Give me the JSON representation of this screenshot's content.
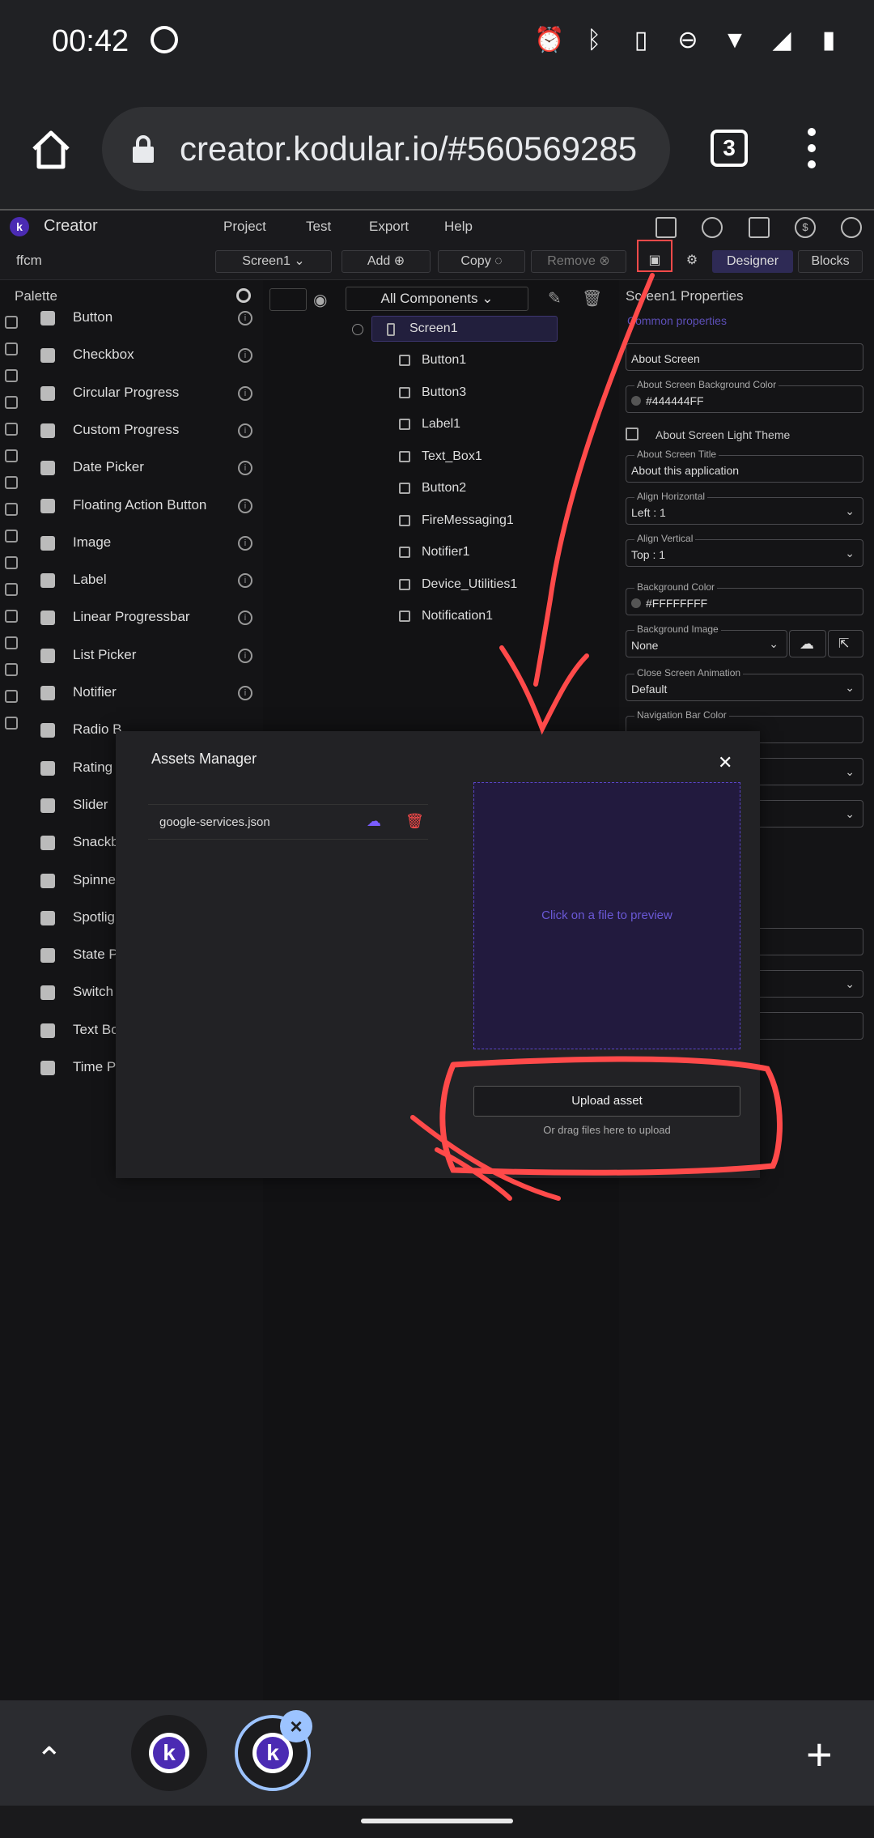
{
  "status": {
    "time": "00:42"
  },
  "browser": {
    "url": "creator.kodular.io/#560569285",
    "tab_count": "3"
  },
  "app": {
    "brand": "Creator",
    "menu": [
      "Project",
      "Test",
      "Export",
      "Help"
    ],
    "project_name": "ffcm",
    "toolbar": {
      "screen": "Screen1",
      "add": "Add",
      "copy": "Copy",
      "remove": "Remove",
      "designer": "Designer",
      "blocks": "Blocks"
    }
  },
  "palette": {
    "title": "Palette",
    "items": [
      {
        "label": "Button"
      },
      {
        "label": "Checkbox"
      },
      {
        "label": "Circular Progress"
      },
      {
        "label": "Custom Progress"
      },
      {
        "label": "Date Picker"
      },
      {
        "label": "Floating Action Button"
      },
      {
        "label": "Image"
      },
      {
        "label": "Label"
      },
      {
        "label": "Linear Progressbar"
      },
      {
        "label": "List Picker"
      },
      {
        "label": "Notifier"
      },
      {
        "label": "Radio B"
      },
      {
        "label": "Rating"
      },
      {
        "label": "Slider"
      },
      {
        "label": "Snackb"
      },
      {
        "label": "Spinne"
      },
      {
        "label": "Spotlig"
      },
      {
        "label": "State P"
      },
      {
        "label": "Switch"
      },
      {
        "label": "Text Bo"
      },
      {
        "label": "Time P"
      }
    ]
  },
  "tree": {
    "filter": "All Components",
    "root": "Screen1",
    "children": [
      "Button1",
      "Button3",
      "Label1",
      "Text_Box1",
      "Button2",
      "FireMessaging1",
      "Notifier1",
      "Device_Utilities1",
      "Notification1"
    ]
  },
  "properties": {
    "title": "Screen1 Properties",
    "subtitle": "Common properties",
    "about_screen": "About Screen",
    "bg_color_label": "About Screen Background Color",
    "bg_color_value": "#444444FF",
    "light_theme": "About Screen Light Theme",
    "title_label": "About Screen Title",
    "title_value": "About this application",
    "align_h_label": "Align Horizontal",
    "align_h_value": "Left : 1",
    "align_v_label": "Align Vertical",
    "align_v_value": "Top : 1",
    "background_color_label": "Background Color",
    "background_color_value": "#FFFFFFFF",
    "background_image_label": "Background Image",
    "background_image_value": "None",
    "close_anim_label": "Close Screen Animation",
    "close_anim_value": "Default",
    "nav_bar_label": "Navigation Bar Color"
  },
  "modal": {
    "title": "Assets Manager",
    "file": "google-services.json",
    "preview_text": "Click on a file to preview",
    "upload_label": "Upload asset",
    "drag_hint": "Or drag files here to upload"
  },
  "colors": {
    "accent": "#4b2bb3",
    "annotation": "#ff4a4a",
    "preview_text": "#6a58d6"
  }
}
